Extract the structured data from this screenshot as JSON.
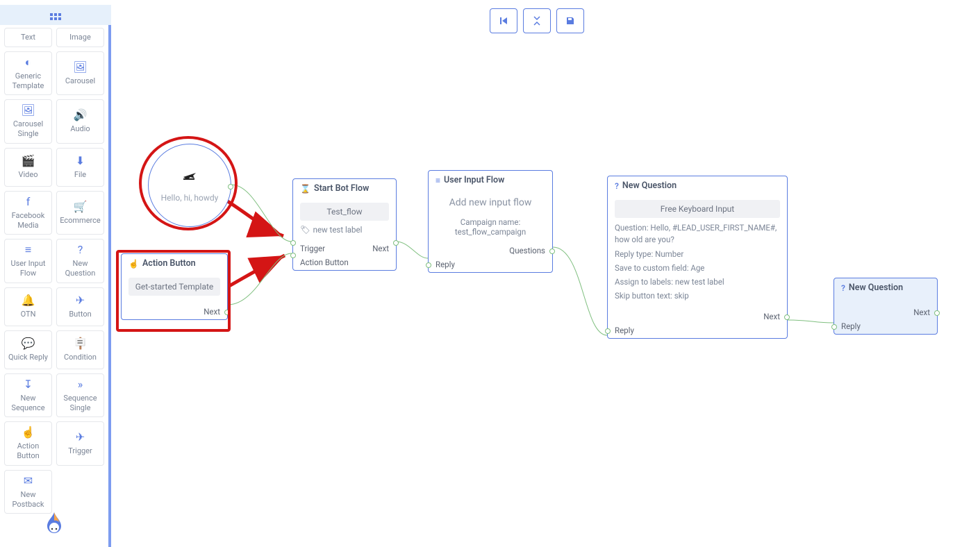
{
  "sidebar": {
    "tools": [
      {
        "icon": "☷",
        "label": "Text"
      },
      {
        "icon": "🖼",
        "label": "Image"
      },
      {
        "icon": "◐",
        "label": "Generic Template"
      },
      {
        "icon": "🖼",
        "label": "Carousel"
      },
      {
        "icon": "🖼",
        "label": "Carousel Single"
      },
      {
        "icon": "🔊",
        "label": "Audio"
      },
      {
        "icon": "🎬",
        "label": "Video"
      },
      {
        "icon": "⬇",
        "label": "File"
      },
      {
        "icon": "f",
        "label": "Facebook Media"
      },
      {
        "icon": "🛒",
        "label": "Ecommerce"
      },
      {
        "icon": "≡",
        "label": "User Input Flow"
      },
      {
        "icon": "?",
        "label": "New Question"
      },
      {
        "icon": "🔔",
        "label": "OTN"
      },
      {
        "icon": "✈",
        "label": "Button"
      },
      {
        "icon": "💬",
        "label": "Quick Reply"
      },
      {
        "icon": "🪧",
        "label": "Condition"
      },
      {
        "icon": "↧",
        "label": "New Sequence"
      },
      {
        "icon": "»",
        "label": "Sequence Single"
      },
      {
        "icon": "☝",
        "label": "Action Button"
      },
      {
        "icon": "✈",
        "label": "Trigger"
      },
      {
        "icon": "✉",
        "label": "New Postback"
      }
    ]
  },
  "toolbar": {
    "grid_icon": "▦"
  },
  "nodes": {
    "trigger": {
      "text": "Hello, hi, howdy"
    },
    "action_button": {
      "title": "Action Button",
      "chip": "Get-started Template",
      "next": "Next"
    },
    "start_bot": {
      "title": "Start Bot Flow",
      "chip": "Test_flow",
      "tag": "new test label",
      "trigger": "Trigger",
      "action": "Action Button",
      "next": "Next"
    },
    "user_input": {
      "title": "User Input Flow",
      "add": "Add new input flow",
      "campaign": "Campaign name: test_flow_campaign",
      "reply": "Reply",
      "questions": "Questions"
    },
    "question1": {
      "title": "New Question",
      "chip": "Free Keyboard Input",
      "q": "Question: Hello, #LEAD_USER_FIRST_NAME#, how old are you?",
      "replytype": "Reply type: Number",
      "save": "Save to custom field: Age",
      "assign": "Assign to labels: new test label",
      "skip": "Skip button text: skip",
      "reply": "Reply",
      "next": "Next"
    },
    "question2": {
      "title": "New Question",
      "reply": "Reply",
      "next": "Next"
    }
  }
}
